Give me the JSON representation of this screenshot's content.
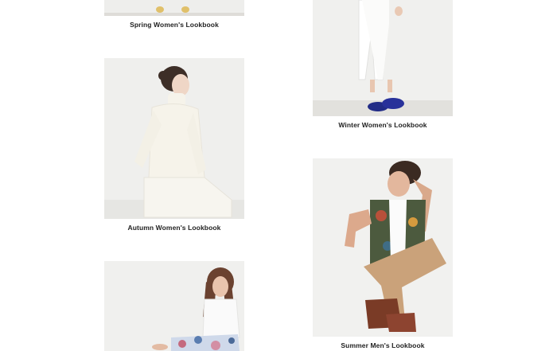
{
  "lookbooks": [
    {
      "title": "Spring Women's Lookbook",
      "photo": "spring-women-photo"
    },
    {
      "title": "Winter Women's Lookbook",
      "photo": "winter-women-photo"
    },
    {
      "title": "Autumn Women's Lookbook",
      "photo": "autumn-women-photo"
    },
    {
      "title": "Summer Men's Lookbook",
      "photo": "summer-men-photo"
    },
    {
      "title": "",
      "photo": "floral-women-photo"
    }
  ],
  "colors": {
    "background": "#ffffff",
    "caption_text": "#222222",
    "photo_backdrop": "#f2f2f2"
  }
}
